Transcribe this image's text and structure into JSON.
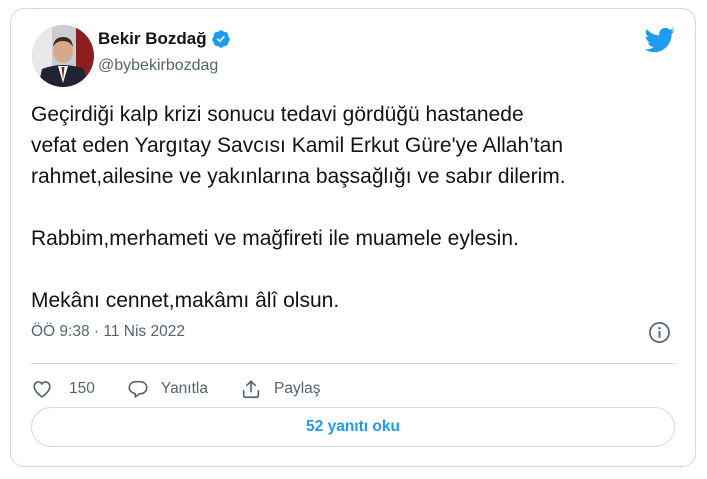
{
  "author": {
    "name": "Bekir Bozdağ",
    "handle": "@bybekirbozdag",
    "verified": true
  },
  "tweet": {
    "text": "Geçirdiği kalp krizi sonucu tedavi gördüğü hastanede\nvefat eden Yargıtay Savcısı Kamil Erkut Güre'ye Allah’tan\nrahmet,ailesine ve yakınlarına başsağlığı ve sabır dilerim.\n\nRabbim,merhameti ve mağfireti ile muamele eylesin.\n\nMekânı cennet,makâmı âlî olsun.",
    "timestamp": "ÖÖ 9:38 · 11 Nis 2022"
  },
  "actions": {
    "like_count": "150",
    "reply_label": "Yanıtla",
    "share_label": "Paylaş"
  },
  "read_replies_label": "52 yanıtı oku",
  "colors": {
    "brand": "#1d9bf0",
    "text": "#0f1419",
    "muted": "#536471",
    "border": "#cfd9de"
  },
  "icons": [
    "verified-badge-icon",
    "twitter-bird-icon",
    "info-icon",
    "heart-icon",
    "reply-bubble-icon",
    "share-icon"
  ]
}
